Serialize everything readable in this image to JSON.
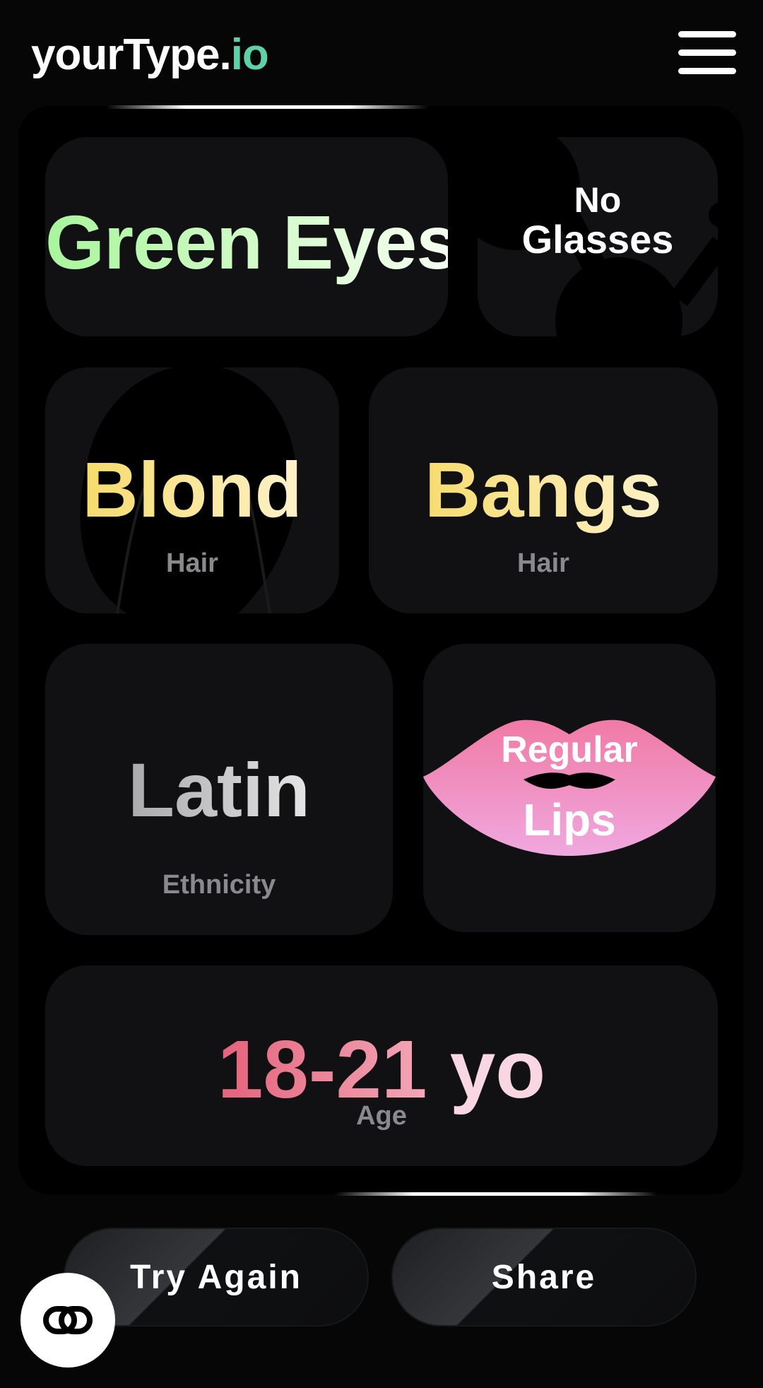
{
  "header": {
    "logo_main": "yourType.",
    "logo_suffix": "io",
    "menu_icon": "hamburger-menu-icon"
  },
  "results": {
    "eyes": {
      "value": "Green Eyes"
    },
    "glasses": {
      "line1": "No",
      "line2": "Glasses",
      "icon": "glasses-icon"
    },
    "hair_color": {
      "value": "Blond",
      "caption": "Hair",
      "icon": "head-silhouette-icon"
    },
    "hair_style": {
      "value": "Bangs",
      "caption": "Hair"
    },
    "ethnicity": {
      "value": "Latin",
      "caption": "Ethnicity"
    },
    "lips": {
      "line1": "Regular",
      "line2": "Lips",
      "icon": "lips-icon"
    },
    "age": {
      "number": "18-21",
      "unit": "yo",
      "caption": "Age"
    }
  },
  "actions": {
    "try_again": "Try Again",
    "share": "Share"
  },
  "fab": {
    "icon": "link-icon"
  },
  "colors": {
    "background": "#060607",
    "card": "#111113",
    "logo_accent": "#5fd1a8",
    "eyes_gradient": [
      "#a9f59c",
      "#f6fff0"
    ],
    "hair_gradient": [
      "#f5d75a",
      "#fff6dc"
    ],
    "lips": [
      "#f07aa5",
      "#f0a8e0"
    ],
    "age_gradient": [
      "#e4627a",
      "#f3a7b8"
    ]
  }
}
